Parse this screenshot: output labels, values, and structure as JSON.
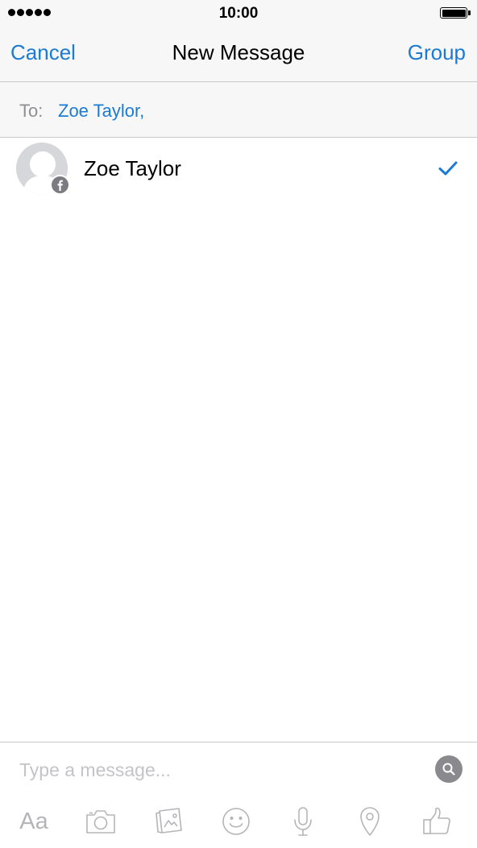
{
  "status_bar": {
    "time": "10:00"
  },
  "nav": {
    "left_label": "Cancel",
    "title": "New Message",
    "right_label": "Group"
  },
  "recipients": {
    "to_label": "To:",
    "selected": "Zoe Taylor,"
  },
  "contacts": [
    {
      "name": "Zoe Taylor",
      "selected": true,
      "source_icon": "facebook-icon"
    }
  ],
  "composer": {
    "placeholder": "Type a message...",
    "text_tool_label": "Aa"
  },
  "toolbar_icons": [
    "text-format-icon",
    "camera-icon",
    "gallery-icon",
    "emoji-icon",
    "microphone-icon",
    "location-icon",
    "like-icon"
  ],
  "colors": {
    "accent": "#1a7bd4",
    "bar_background": "#f7f7f7",
    "separator": "#c8c8cc",
    "muted_icon": "#b5b5b9"
  }
}
